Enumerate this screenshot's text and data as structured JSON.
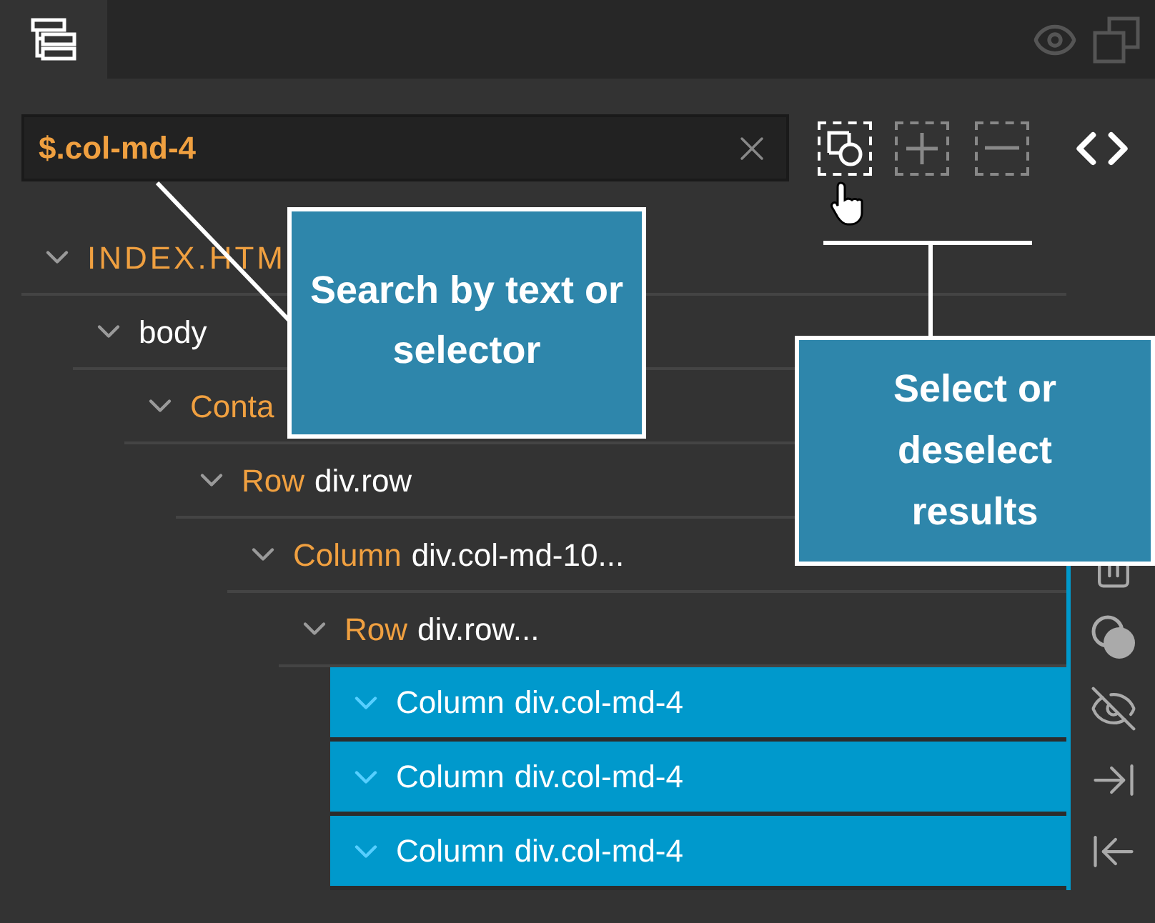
{
  "search": {
    "value": "$.col-md-4"
  },
  "tree": [
    {
      "kind": "file",
      "label": "INDEX.HTM",
      "selected": false,
      "children": [
        {
          "kind": "element",
          "label": "body",
          "selected": false,
          "children": [
            {
              "kind": "component",
              "label": "Conta",
              "selected": false,
              "children": [
                {
                  "kind": "component",
                  "label": "Row",
                  "detail": "div.row",
                  "selected": false,
                  "children": [
                    {
                      "kind": "component",
                      "label": "Column",
                      "detail": "div.col-md-10...",
                      "selected": false,
                      "children": [
                        {
                          "kind": "component",
                          "label": "Row",
                          "detail": "div.row...",
                          "selected": false,
                          "children": [
                            {
                              "kind": "component",
                              "label": "Column",
                              "detail": "div.col-md-4",
                              "selected": true
                            },
                            {
                              "kind": "component",
                              "label": "Column",
                              "detail": "div.col-md-4",
                              "selected": true
                            },
                            {
                              "kind": "component",
                              "label": "Column",
                              "detail": "div.col-md-4",
                              "selected": true
                            }
                          ]
                        }
                      ]
                    }
                  ]
                }
              ]
            }
          ]
        }
      ]
    }
  ],
  "callouts": [
    {
      "text": "Search by text or selector"
    },
    {
      "text": "Select or deselect results"
    }
  ]
}
